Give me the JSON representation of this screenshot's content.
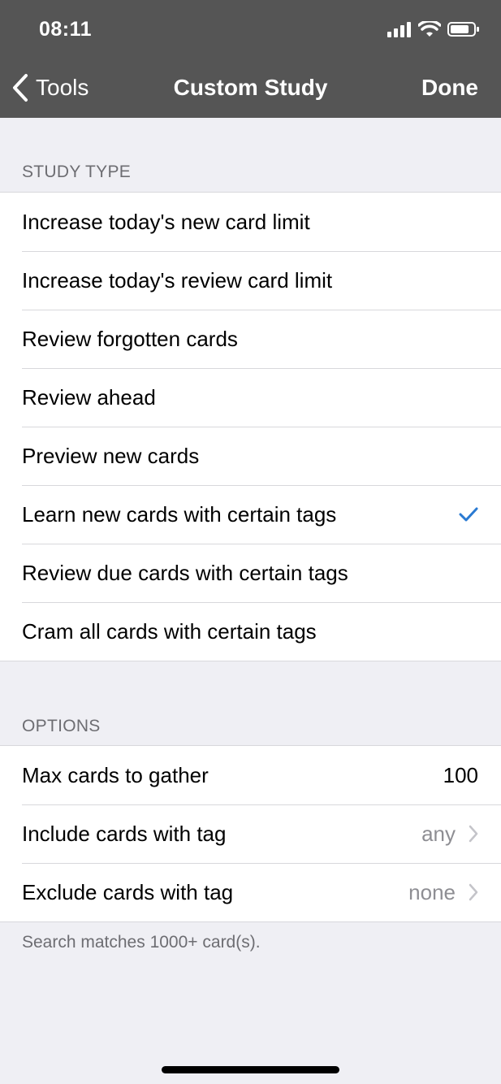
{
  "status": {
    "time": "08:11"
  },
  "nav": {
    "back_label": "Tools",
    "title": "Custom Study",
    "done_label": "Done"
  },
  "study_type": {
    "header": "STUDY TYPE",
    "items": [
      {
        "label": "Increase today's new card limit",
        "selected": false
      },
      {
        "label": "Increase today's review card limit",
        "selected": false
      },
      {
        "label": "Review forgotten cards",
        "selected": false
      },
      {
        "label": "Review ahead",
        "selected": false
      },
      {
        "label": "Preview new cards",
        "selected": false
      },
      {
        "label": "Learn new cards with certain tags",
        "selected": true
      },
      {
        "label": "Review due cards with certain tags",
        "selected": false
      },
      {
        "label": "Cram all cards with certain tags",
        "selected": false
      }
    ]
  },
  "options": {
    "header": "OPTIONS",
    "max_cards": {
      "label": "Max cards to gather",
      "value": "100"
    },
    "include": {
      "label": "Include cards with tag",
      "value": "any"
    },
    "exclude": {
      "label": "Exclude cards with tag",
      "value": "none"
    }
  },
  "footer": {
    "note": "Search matches 1000+ card(s)."
  },
  "colors": {
    "bar": "#555555",
    "accent": "#2a7ad2",
    "background": "#efeff4"
  }
}
